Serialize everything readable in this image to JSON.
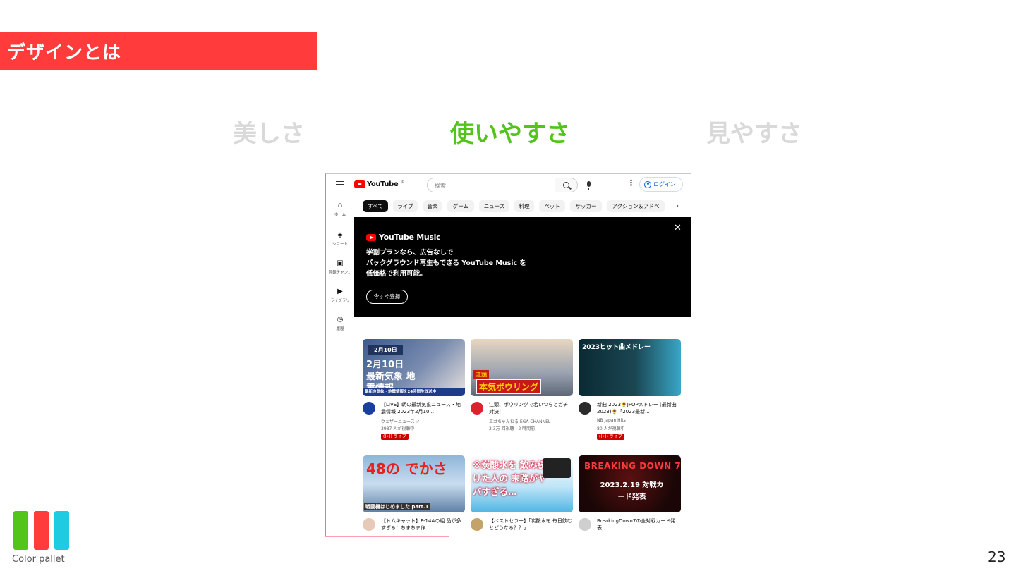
{
  "slide": {
    "title": "デザインとは",
    "tabs": [
      {
        "label": "美しさ",
        "active": false
      },
      {
        "label": "使いやすさ",
        "active": true
      },
      {
        "label": "見やすさ",
        "active": false
      }
    ],
    "page_number": "23",
    "palette_label": "Color pallet",
    "palette_colors": [
      "#52c41a",
      "#ff3b3b",
      "#1ecbe1"
    ],
    "accent_color": "#ff3b3b",
    "active_tab_color": "#52c41a"
  },
  "youtube": {
    "logo_text": "YouTube",
    "logo_sup": "JP",
    "search_placeholder": "検索",
    "login_label": "ログイン",
    "chips": [
      "すべて",
      "ライブ",
      "音楽",
      "ゲーム",
      "ニュース",
      "料理",
      "ペット",
      "サッカー",
      "アクション＆アドベ"
    ],
    "sidebar": [
      {
        "label": "ホーム",
        "icon": "home-icon"
      },
      {
        "label": "ショート",
        "icon": "shorts-icon"
      },
      {
        "label": "登録チャン...",
        "icon": "subscriptions-icon"
      },
      {
        "label": "ライブラリ",
        "icon": "library-icon"
      },
      {
        "label": "履歴",
        "icon": "history-icon"
      }
    ],
    "banner": {
      "logo_text": "YouTube Music",
      "line1": "学割プランなら、広告なしで",
      "line2": "バックグラウンド再生もできる YouTube Music を",
      "line3": "低価格で利用可能。",
      "button": "今すぐ登録"
    },
    "videos": [
      {
        "thumb_text": "2月10日 最新気象 地震情報",
        "thumb_sub": "最新の気象・地震情報を24時間生放送中",
        "title": "【LIVE】朝の最新気象ニュース・地震情報 2023年2月10...",
        "channel": "ウェザーニュース ✔",
        "meta": "3987 人が視聴中",
        "live": "((•)) ライブ"
      },
      {
        "thumb_text": "本気ボウリング",
        "thumb_sub": "江頭",
        "title": "江頭、ボウリングで若いつらとガチ対決！",
        "channel": "エガちゃんねる EGA CHANNEL",
        "meta": "2.3万 回視聴・2 時間前",
        "live": ""
      },
      {
        "thumb_text": "2023ヒット曲メドレー",
        "thumb_sub": "",
        "title": "新曲 2023🌻JPOPメドレー (最新曲 2023)🌻「2023最新...",
        "channel": "NB Japan Hits",
        "meta": "80 人が視聴中",
        "live": "((•)) ライブ"
      },
      {
        "thumb_text": "48の でかさ",
        "thumb_sub": "戦闘機はじめました part.1",
        "title": "【トムキャット】F-14Aの組 品が多すぎる！ちまちま作...",
        "channel": "",
        "meta": "",
        "live": ""
      },
      {
        "thumb_text": "※炭酸水を 飲み続けた人の 末路がヤバすぎる…",
        "thumb_sub": "",
        "title": "【ベストセラー】「炭酸水を 毎日飲むとどうなる？？」...",
        "channel": "",
        "meta": "",
        "live": ""
      },
      {
        "thumb_text": "BREAKING DOWN 7",
        "thumb_sub": "2023.2.19 対戦カード発表",
        "title": "BreakingDown7の全対戦カード発表",
        "channel": "",
        "meta": "",
        "live": ""
      }
    ]
  }
}
